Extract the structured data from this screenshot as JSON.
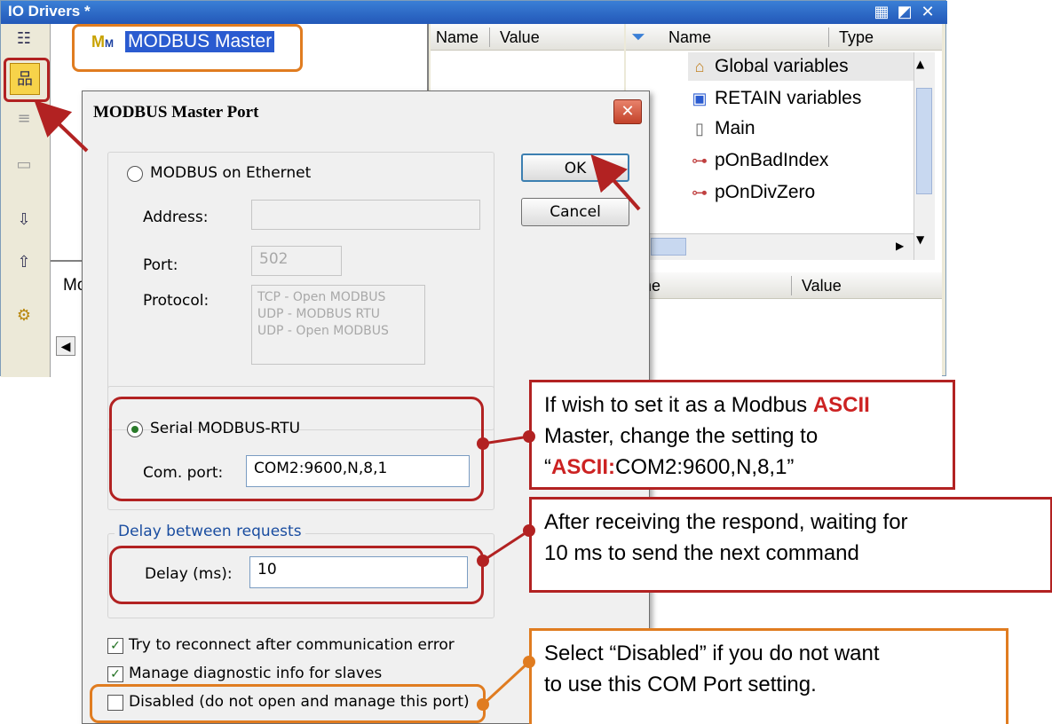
{
  "window": {
    "title": "IO Drivers *",
    "controls": [
      "tile-icon",
      "restore-icon",
      "close-icon"
    ]
  },
  "tree": {
    "item": "MODBUS Master"
  },
  "var_pane": {
    "col_name": "Name",
    "col_value": "Value"
  },
  "right_pane": {
    "col_name": "Name",
    "col_type": "Type",
    "items": [
      "Global variables",
      "RETAIN variables",
      "Main",
      "pOnBadIndex",
      "pOnDivZero"
    ],
    "bottom_col_name": "ame",
    "bottom_col_value": "Value"
  },
  "bottom_tab": "Mo",
  "dialog": {
    "title": "MODBUS Master Port",
    "ok": "OK",
    "cancel": "Cancel",
    "ethernet": {
      "label": "MODBUS on Ethernet",
      "address_label": "Address:",
      "address_value": "",
      "port_label": "Port:",
      "port_value": "502",
      "protocol_label": "Protocol:",
      "protocols": [
        "TCP - Open MODBUS",
        "UDP - MODBUS RTU",
        "UDP - Open MODBUS"
      ]
    },
    "serial": {
      "label": "Serial MODBUS-RTU",
      "com_label": "Com. port:",
      "com_value": "COM2:9600,N,8,1"
    },
    "delay": {
      "group_label": "Delay between requests",
      "label": "Delay (ms):",
      "value": "10"
    },
    "options": [
      {
        "label": "Try to reconnect after communication error",
        "checked": true
      },
      {
        "label": "Manage diagnostic info for slaves",
        "checked": true
      },
      {
        "label": "Disabled (do not open and manage this port)",
        "checked": false
      }
    ]
  },
  "callouts": {
    "ascii": {
      "l1a": "If wish to set it as a Modbus ",
      "l1b": "ASCII",
      "l2": "Master, change the setting to",
      "l3a": "“",
      "l3b": "ASCII:",
      "l3c": "COM2:9600,N,8,1”"
    },
    "delay": {
      "l1": "After receiving the respond, waiting for",
      "l2": "10 ms to send the next command"
    },
    "disabled": {
      "l1": "Select “Disabled” if you do not want",
      "l2": "to use this COM Port setting."
    }
  },
  "colors": {
    "highlight_red": "#b22222",
    "highlight_orange": "#e07c20",
    "ascii_text": "#cc2222"
  }
}
